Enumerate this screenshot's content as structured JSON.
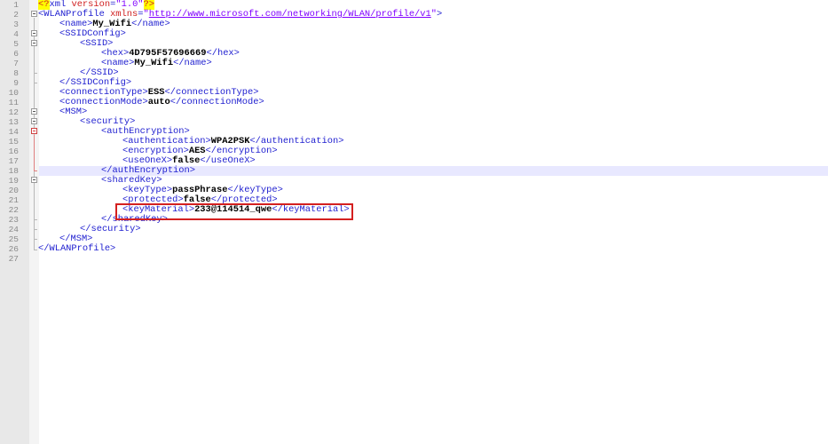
{
  "editor": {
    "line_numbers": [
      "1",
      "2",
      "3",
      "4",
      "5",
      "6",
      "7",
      "8",
      "9",
      "10",
      "11",
      "12",
      "13",
      "14",
      "15",
      "16",
      "17",
      "18",
      "19",
      "20",
      "21",
      "22",
      "23",
      "24",
      "25",
      "26",
      "27"
    ],
    "lines": {
      "l1": {
        "open": "<",
        "pi": "?",
        "name": "xml",
        "attr": " version",
        "eq": "=",
        "value": "\"1.0\"",
        "close": "?>"
      },
      "l2": {
        "open": "<WLANProfile",
        "attr": " xmlns",
        "eq": "=",
        "q1": "\"",
        "url": "http://www.microsoft.com/networking/WLAN/profile/v1",
        "q2": "\"",
        "close": ">"
      },
      "l3": {
        "open": "<name>",
        "text": "My_Wifi",
        "close": "</name>"
      },
      "l4": {
        "open": "<SSIDConfig>"
      },
      "l5": {
        "open": "<SSID>"
      },
      "l6": {
        "open": "<hex>",
        "text": "4D795F57696669",
        "close": "</hex>"
      },
      "l7": {
        "open": "<name>",
        "text": "My_Wifi",
        "close": "</name>"
      },
      "l8": {
        "close": "</SSID>"
      },
      "l9": {
        "close": "</SSIDConfig>"
      },
      "l10": {
        "open": "<connectionType>",
        "text": "ESS",
        "close": "</connectionType>"
      },
      "l11": {
        "open": "<connectionMode>",
        "text": "auto",
        "close": "</connectionMode>"
      },
      "l12": {
        "open": "<MSM>"
      },
      "l13": {
        "open": "<security>"
      },
      "l14": {
        "open": "<authEncryption>"
      },
      "l15": {
        "open": "<authentication>",
        "text": "WPA2PSK",
        "close": "</authentication>"
      },
      "l16": {
        "open": "<encryption>",
        "text": "AES",
        "close": "</encryption>"
      },
      "l17": {
        "open": "<useOneX>",
        "text": "false",
        "close": "</useOneX>"
      },
      "l18": {
        "close": "</authEncryption>"
      },
      "l19": {
        "open": "<sharedKey>"
      },
      "l20": {
        "open": "<keyType>",
        "text": "passPhrase",
        "close": "</keyType>"
      },
      "l21": {
        "open": "<protected>",
        "text": "false",
        "close": "</protected>"
      },
      "l22": {
        "open": "<keyMaterial>",
        "text": "233@114514_qwe",
        "close": "</keyMaterial>"
      },
      "l23": {
        "close": "</sharedKey>"
      },
      "l24": {
        "close": "</security>"
      },
      "l25": {
        "close": "</MSM>"
      },
      "l26": {
        "close": "</WLANProfile>"
      }
    },
    "highlighted_line": "18",
    "annotation_color": "#d42020"
  }
}
